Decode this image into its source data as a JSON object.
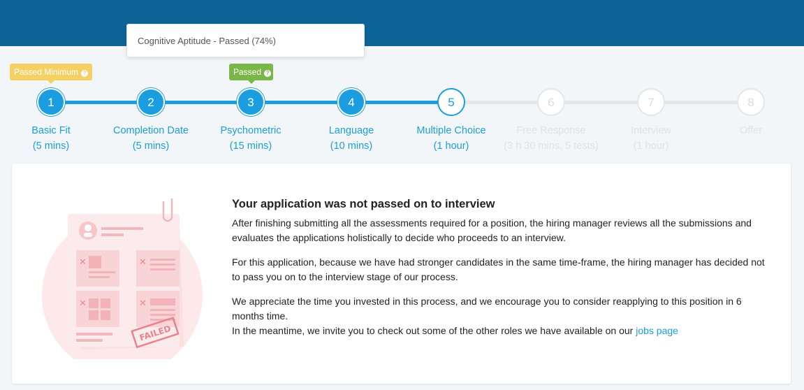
{
  "tooltip": {
    "text": "Cognitive Aptitude - Passed (74%)"
  },
  "badges": {
    "passed_minimum": "Passed Minimum",
    "passed": "Passed"
  },
  "steps": [
    {
      "number": "1",
      "name": "Basic Fit",
      "duration": "(5 mins)",
      "state": "done"
    },
    {
      "number": "2",
      "name": "Completion Date",
      "duration": "(5 mins)",
      "state": "done"
    },
    {
      "number": "3",
      "name": "Psychometric",
      "duration": "(15 mins)",
      "state": "done"
    },
    {
      "number": "4",
      "name": "Language",
      "duration": "(10 mins)",
      "state": "done"
    },
    {
      "number": "5",
      "name": "Multiple Choice",
      "duration": "(1 hour)",
      "state": "current"
    },
    {
      "number": "6",
      "name": "Free Response",
      "duration": "(3 h 30 mins, 5 tests)",
      "state": "todo"
    },
    {
      "number": "7",
      "name": "Interview",
      "duration": "(1 hour)",
      "state": "todo"
    },
    {
      "number": "8",
      "name": "Offer",
      "duration": "",
      "state": "todo"
    }
  ],
  "illustration": {
    "stamp_text": "FAILED",
    "icon": "failed-application-icon"
  },
  "message": {
    "title": "Your application was not passed on to interview",
    "p1": "After finishing submitting all the assessments required for a position, the hiring manager reviews all the submissions and evaluates the applications holistically to decide who proceeds to an interview.",
    "p2": "For this application, because we have had stronger candidates in the same time-frame, the hiring manager has decided not to pass you on to the interview stage of our process.",
    "p3": "We appreciate the time you invested in this process, and we encourage you to consider reapplying to this position in 6 months time.",
    "p4_prefix": "In the meantime, we invite you to check out some of the other roles we have available on our ",
    "jobs_link": "jobs page"
  },
  "colors": {
    "header": "#0b6397",
    "accent": "#1a9ee0",
    "badge_yellow": "#f5d062",
    "badge_green": "#7ab748",
    "inactive": "#dfe2e5"
  }
}
